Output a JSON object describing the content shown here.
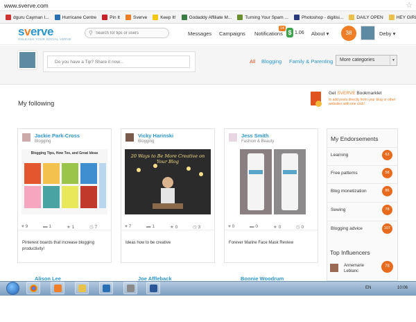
{
  "browser": {
    "url": "www.sverve.com",
    "bookmarks": [
      "dguru Cayman I...",
      "Hurricane Centre",
      "Pin It",
      "Sverve",
      "Keep It!",
      "Godaddy Affiliate M...",
      "Turning Your Spam ...",
      "Photoshop - digitisi...",
      "DAILY OPEN",
      "HEY GIRL"
    ],
    "bookmark_colors": [
      "#c33",
      "#2a6fb4",
      "#cb2027",
      "#f07e26",
      "#f5c518",
      "#3a7d44",
      "#6a8f2e",
      "#2a3a7a",
      "#e8c24a",
      "#e8c24a"
    ]
  },
  "header": {
    "logo": "sverve",
    "tagline": "UNLEASH YOUR SOCIAL VERVE",
    "search_placeholder": "Search for tips or users",
    "nav": [
      "Messages",
      "Campaigns",
      "Notifications",
      "About ▾"
    ],
    "notification_count": "14",
    "money": "1.06",
    "score": "38",
    "username": "Deby ▾"
  },
  "tip": {
    "placeholder": "Do you have a Tip? Share it now...",
    "filters": [
      "All",
      "Blogging",
      "Family & Parenting"
    ],
    "more": "More categories"
  },
  "following": {
    "title": "My following",
    "bookmarklet_title_prefix": "Get ",
    "bookmarklet_brand": "SVERVE",
    "bookmarklet_title_suffix": " Bookmarklet",
    "bookmarklet_sub": "to add posts directly from your blog or other websites with one click!"
  },
  "cards": [
    {
      "name": "Jackie Park-Cross",
      "category": "Blogging",
      "stats": [
        "9",
        "1",
        "1",
        "7"
      ],
      "desc": "Pinterest boards that increase blogging productivity!",
      "img_title": "Blogging Tips, How Tos, and Great Ideas"
    },
    {
      "name": "Vicky Harinski",
      "category": "Blogging",
      "stats": [
        "7",
        "1",
        "0",
        "3"
      ],
      "desc": "Ideas how to be creative",
      "img_title": "20 Ways to Be More Creative on Your Blog"
    },
    {
      "name": "Jess Smith",
      "category": "Fashion & Beauty",
      "stats": [
        "0",
        "0",
        "0",
        "0"
      ],
      "desc": "Forever Marine Face Mask Review",
      "img_title": ""
    }
  ],
  "endorsements": {
    "title": "My Endorsements",
    "items": [
      {
        "label": "Learning",
        "count": "63"
      },
      {
        "label": "Free patterns",
        "count": "58"
      },
      {
        "label": "Blog monetization",
        "count": "86"
      },
      {
        "label": "Sewing",
        "count": "78"
      },
      {
        "label": "Blogging advice",
        "count": "107"
      }
    ]
  },
  "influencers": {
    "title": "Top Influencers",
    "name": "Annemarie Leblanc",
    "count": "78"
  },
  "peek_names": [
    "Alison Lee",
    "Joe Affleback",
    "Bonnie Woodrum"
  ],
  "taskbar": {
    "lang": "EN",
    "time": "10:06"
  }
}
